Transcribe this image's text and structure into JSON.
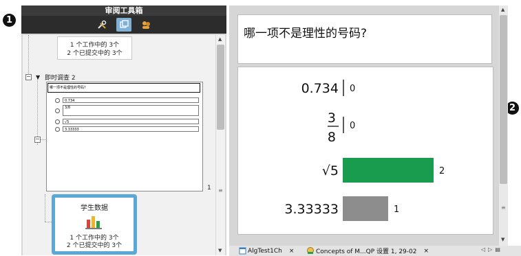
{
  "callouts": [
    "1",
    "2"
  ],
  "toolbox": {
    "title": "审阅工具箱",
    "tabs": [
      {
        "name": "tools",
        "icon": "tools-icon"
      },
      {
        "name": "review",
        "icon": "review-icon",
        "active": true
      },
      {
        "name": "class",
        "icon": "class-icon"
      }
    ]
  },
  "tree": {
    "top_status": [
      "1 个工作中的 3个",
      "2 个已提交中的 3个"
    ],
    "question_label": "即时调查 2",
    "thumbnail": {
      "question": "哪一项不是理性的号码?",
      "options": [
        "0.734",
        "3/8",
        "√5",
        "3.33333"
      ]
    },
    "thumbnail_count": "1",
    "student_data": {
      "title": "学生数据",
      "status": [
        "1 个工作中的 3个",
        "2 个已提交中的 3个"
      ]
    }
  },
  "main": {
    "question": "哪一项不是理性的号码?"
  },
  "chart_data": {
    "type": "bar",
    "orientation": "horizontal",
    "categories": [
      "0.734",
      "3/8",
      "√5",
      "3.33333"
    ],
    "values": [
      0,
      0,
      2,
      1
    ],
    "bar_colors": [
      "#5a5a5a",
      "#5a5a5a",
      "#1a9c4e",
      "#8d8d8d"
    ]
  },
  "doc_tabs": [
    {
      "label": "AlgTest1Ch",
      "close": "×"
    },
    {
      "label": "Concepts of M...QP 设置 1, 29-02",
      "close": "×"
    }
  ],
  "nav": {
    "prev": "◁",
    "next": "▷",
    "menu": "▤"
  }
}
